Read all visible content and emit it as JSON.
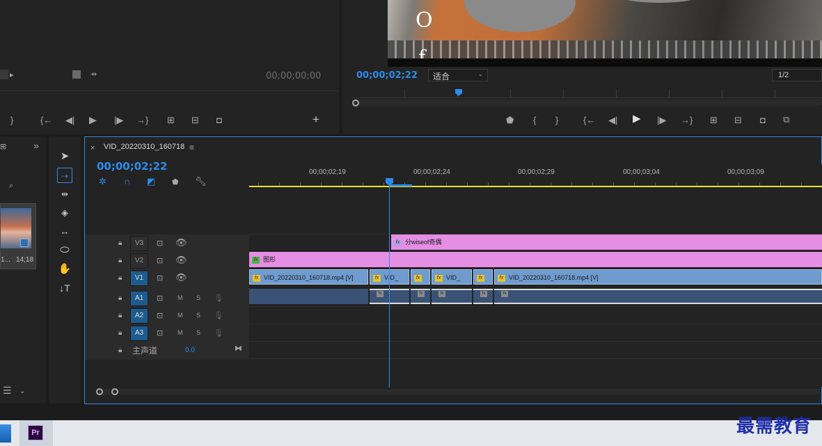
{
  "source_monitor": {
    "timecode": "00;00;00;00",
    "controls": [
      "{",
      "{←",
      "◀|",
      "▶",
      "|▶",
      "→}"
    ]
  },
  "program_monitor": {
    "timecode": "00;00;02;22",
    "zoom_value": "适合",
    "zoom_options": [
      "适合"
    ],
    "resolution": "1/2",
    "overlay_letter": "O",
    "overlay_letter2": "f",
    "playhead_fraction": 0.2
  },
  "project_panel": {
    "clip_duration": "14;18",
    "clip_name_short": "1..."
  },
  "timeline": {
    "sequence_name": "VID_20220310_160718",
    "timecode": "00;00;02;22",
    "ruler_labels": [
      "00;00;02;19",
      "00;00;02;24",
      "00;00;02;29",
      "00;00;03;04",
      "00;00;03;09"
    ],
    "tracks": {
      "v3": "V3",
      "v2": "V2",
      "v1": "V1",
      "a1": "A1",
      "a2": "A2",
      "a3": "A3",
      "mute": "M",
      "solo": "S",
      "master_label": "主声道",
      "master_value": "0.0"
    },
    "clips": {
      "v3_title": "分wiseof奇偶",
      "v2_graphic": "图形",
      "v1_a": "VID_20220310_160718.mp4 [V]",
      "v1_b": "VID_",
      "v1_c": "VID_",
      "v1_d": "VID_20220310_160718.mp4 [V]",
      "fx": "fx"
    }
  },
  "taskbar": {
    "premiere_label": "Pr"
  },
  "watermark": "最需教育",
  "colors": {
    "accent": "#2d8ceb",
    "video_clip": "#6f9bcf",
    "graphic_clip": "#e48ee4",
    "audio_clip": "#3a5276",
    "work_area": "#f0e020"
  }
}
